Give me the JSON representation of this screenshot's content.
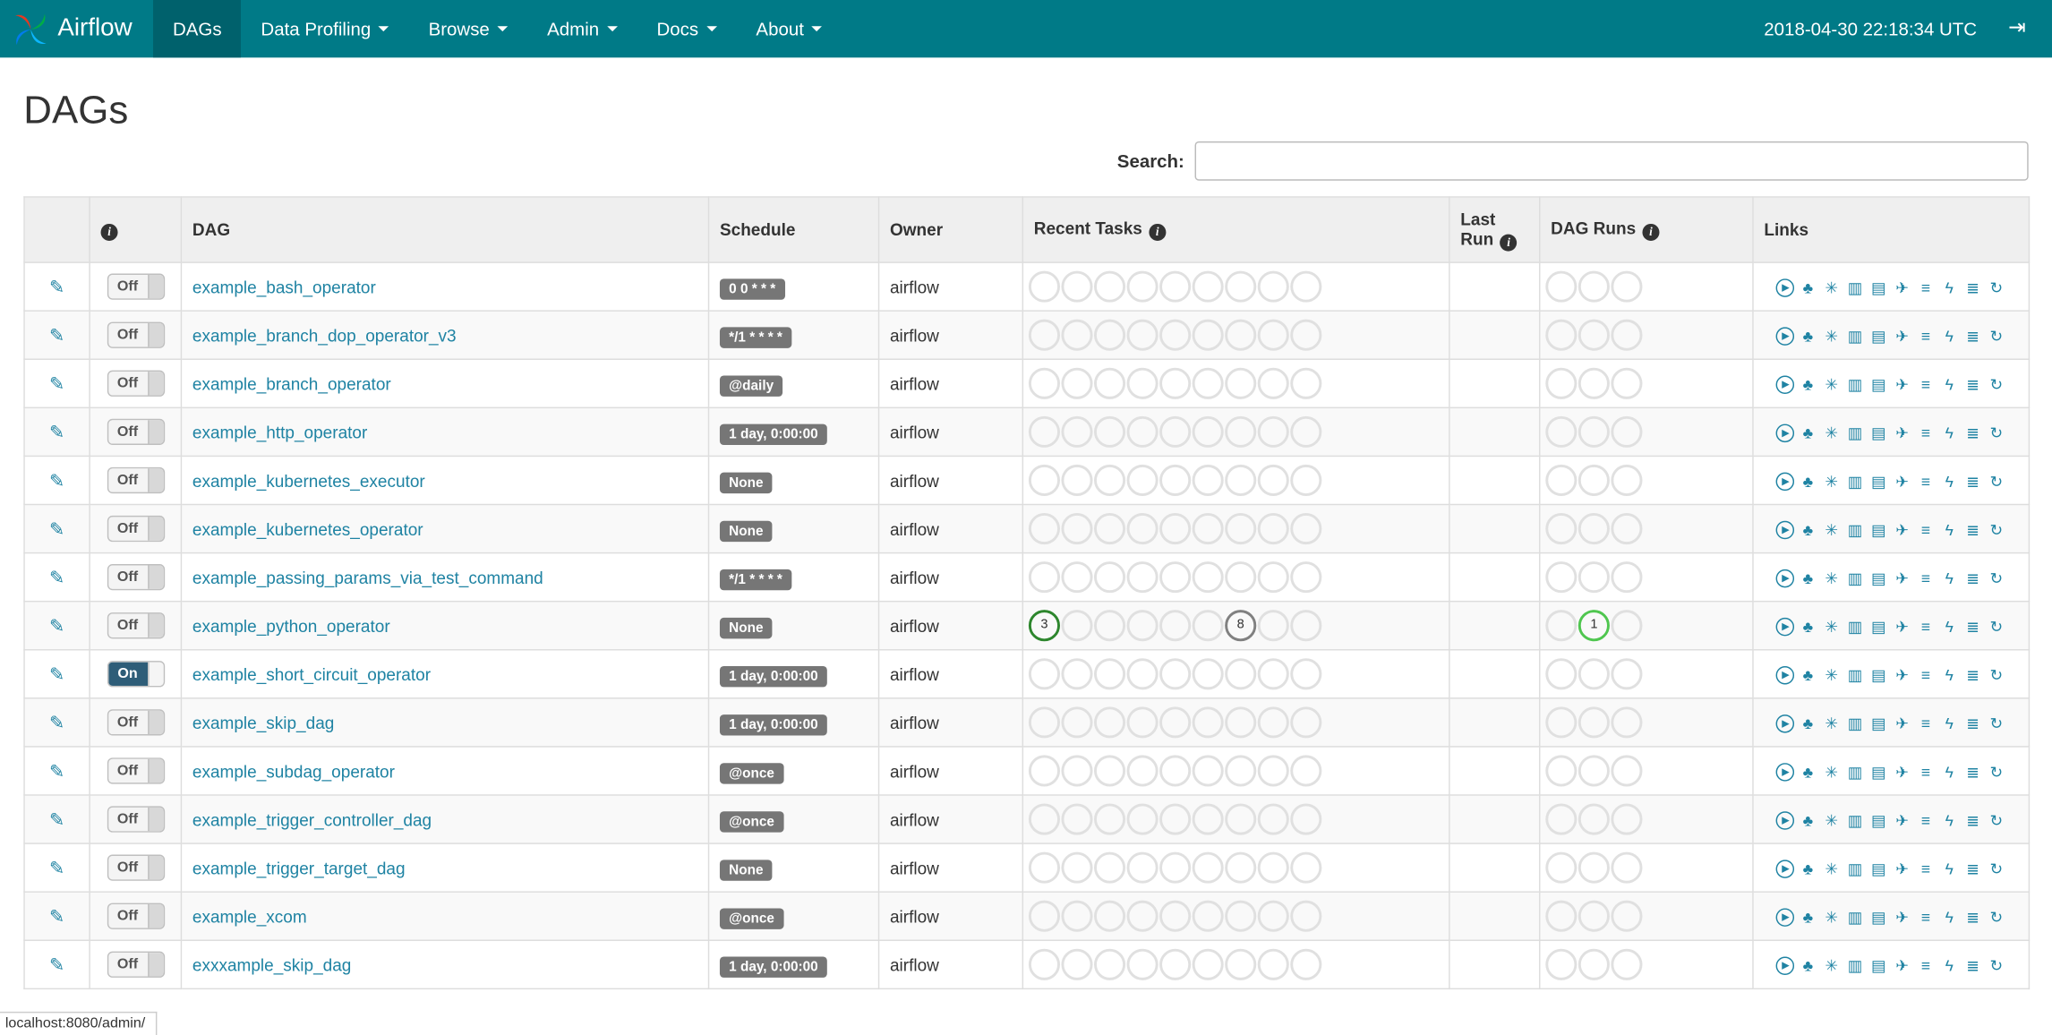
{
  "navbar": {
    "brand": "Airflow",
    "items": [
      {
        "label": "DAGs",
        "active": true,
        "dropdown": false
      },
      {
        "label": "Data Profiling",
        "active": false,
        "dropdown": true
      },
      {
        "label": "Browse",
        "active": false,
        "dropdown": true
      },
      {
        "label": "Admin",
        "active": false,
        "dropdown": true
      },
      {
        "label": "Docs",
        "active": false,
        "dropdown": true
      },
      {
        "label": "About",
        "active": false,
        "dropdown": true
      }
    ],
    "clock": "2018-04-30 22:18:34 UTC"
  },
  "page": {
    "title": "DAGs"
  },
  "search": {
    "label": "Search:",
    "value": ""
  },
  "statusbar": {
    "text": "localhost:8080/admin/"
  },
  "colors": {
    "navbar_bg": "#007A87",
    "navbar_active_bg": "#00616C",
    "link": "#1F83A3",
    "badge_bg": "#767676",
    "toggle_on_bg": "#2E5D78",
    "circle_empty_border": "#E0E0E0",
    "task_success_green": "#2D862D",
    "task_gray": "#808080",
    "dagrun_running_green": "#4FC64F"
  },
  "table": {
    "columns": [
      {
        "key": "edit",
        "label": "",
        "info": false
      },
      {
        "key": "info",
        "label": "",
        "info": true
      },
      {
        "key": "dag",
        "label": "DAG",
        "info": false
      },
      {
        "key": "schedule",
        "label": "Schedule",
        "info": false
      },
      {
        "key": "owner",
        "label": "Owner",
        "info": false
      },
      {
        "key": "recent-tasks",
        "label": "Recent Tasks",
        "info": true
      },
      {
        "key": "last-run",
        "label": "Last Run",
        "info": true
      },
      {
        "key": "dag-runs",
        "label": "DAG Runs",
        "info": true
      },
      {
        "key": "links",
        "label": "Links",
        "info": false
      }
    ],
    "toggle": {
      "on_label": "On",
      "off_label": "Off"
    },
    "recent_task_slots": 9,
    "dag_run_slots": 3,
    "links": [
      {
        "name": "trigger-dag-icon",
        "glyph": "play-circle"
      },
      {
        "name": "tree-view-icon",
        "glyph": "tree"
      },
      {
        "name": "graph-view-icon",
        "glyph": "burst"
      },
      {
        "name": "task-duration-icon",
        "glyph": "bar-chart"
      },
      {
        "name": "task-tries-icon",
        "glyph": "duplicate"
      },
      {
        "name": "landing-times-icon",
        "glyph": "plane"
      },
      {
        "name": "gantt-icon",
        "glyph": "align-left"
      },
      {
        "name": "code-view-icon",
        "glyph": "flash"
      },
      {
        "name": "log-icon",
        "glyph": "align-justify"
      },
      {
        "name": "refresh-icon",
        "glyph": "refresh"
      }
    ],
    "rows": [
      {
        "dag_id": "example_bash_operator",
        "enabled": false,
        "schedule": "0 0 * * *",
        "owner": "airflow",
        "recent_tasks": [],
        "last_run": "",
        "dag_runs": []
      },
      {
        "dag_id": "example_branch_dop_operator_v3",
        "enabled": false,
        "schedule": "*/1 * * * *",
        "owner": "airflow",
        "recent_tasks": [],
        "last_run": "",
        "dag_runs": []
      },
      {
        "dag_id": "example_branch_operator",
        "enabled": false,
        "schedule": "@daily",
        "owner": "airflow",
        "recent_tasks": [],
        "last_run": "",
        "dag_runs": []
      },
      {
        "dag_id": "example_http_operator",
        "enabled": false,
        "schedule": "1 day, 0:00:00",
        "owner": "airflow",
        "recent_tasks": [],
        "last_run": "",
        "dag_runs": []
      },
      {
        "dag_id": "example_kubernetes_executor",
        "enabled": false,
        "schedule": "None",
        "owner": "airflow",
        "recent_tasks": [],
        "last_run": "",
        "dag_runs": []
      },
      {
        "dag_id": "example_kubernetes_operator",
        "enabled": false,
        "schedule": "None",
        "owner": "airflow",
        "recent_tasks": [],
        "last_run": "",
        "dag_runs": []
      },
      {
        "dag_id": "example_passing_params_via_test_command",
        "enabled": false,
        "schedule": "*/1 * * * *",
        "owner": "airflow",
        "recent_tasks": [],
        "last_run": "",
        "dag_runs": []
      },
      {
        "dag_id": "example_python_operator",
        "enabled": false,
        "schedule": "None",
        "owner": "airflow",
        "recent_tasks": [
          {
            "slot": 0,
            "count": "3",
            "color": "#2D862D"
          },
          {
            "slot": 6,
            "count": "8",
            "color": "#808080"
          }
        ],
        "last_run": "",
        "dag_runs": [
          {
            "slot": 1,
            "count": "1",
            "color": "#4FC64F"
          }
        ]
      },
      {
        "dag_id": "example_short_circuit_operator",
        "enabled": true,
        "schedule": "1 day, 0:00:00",
        "owner": "airflow",
        "recent_tasks": [],
        "last_run": "",
        "dag_runs": []
      },
      {
        "dag_id": "example_skip_dag",
        "enabled": false,
        "schedule": "1 day, 0:00:00",
        "owner": "airflow",
        "recent_tasks": [],
        "last_run": "",
        "dag_runs": []
      },
      {
        "dag_id": "example_subdag_operator",
        "enabled": false,
        "schedule": "@once",
        "owner": "airflow",
        "recent_tasks": [],
        "last_run": "",
        "dag_runs": []
      },
      {
        "dag_id": "example_trigger_controller_dag",
        "enabled": false,
        "schedule": "@once",
        "owner": "airflow",
        "recent_tasks": [],
        "last_run": "",
        "dag_runs": []
      },
      {
        "dag_id": "example_trigger_target_dag",
        "enabled": false,
        "schedule": "None",
        "owner": "airflow",
        "recent_tasks": [],
        "last_run": "",
        "dag_runs": []
      },
      {
        "dag_id": "example_xcom",
        "enabled": false,
        "schedule": "@once",
        "owner": "airflow",
        "recent_tasks": [],
        "last_run": "",
        "dag_runs": []
      },
      {
        "dag_id": "exxxample_skip_dag",
        "enabled": false,
        "schedule": "1 day, 0:00:00",
        "owner": "airflow",
        "recent_tasks": [],
        "last_run": "",
        "dag_runs": []
      }
    ]
  }
}
